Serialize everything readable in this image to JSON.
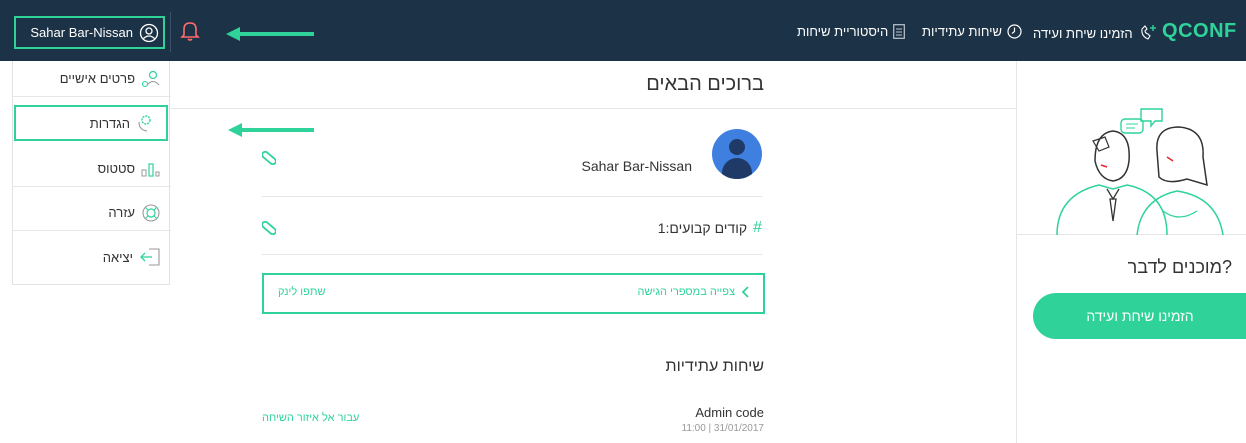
{
  "topbar": {
    "user_name": "Sahar Bar-Nissan",
    "nav": {
      "history": "היסטוריית שיחות",
      "future": "שיחות עתידיות",
      "invite": "הזמינו שיחת ועידה"
    },
    "logo_q": "Q",
    "logo_text": "CONF"
  },
  "menu": {
    "items": [
      {
        "label": "פרטים אישיים",
        "icon": "person-icon"
      },
      {
        "label": "הגדרות",
        "icon": "settings-icon"
      },
      {
        "label": "סטטוס",
        "icon": "status-icon"
      },
      {
        "label": "עזרה",
        "icon": "help-icon"
      },
      {
        "label": "יציאה",
        "icon": "logout-icon"
      }
    ]
  },
  "main": {
    "welcome": "ברוכים הבאים",
    "profile_name": "Sahar Bar-Nissan",
    "codes": "קודים קבועים:1",
    "link_view": "צפייה במספרי הגישה",
    "link_share": "שתפו לינק",
    "future_title": "שיחות עתידיות",
    "conf_code": "Admin code",
    "conf_time": "11:00 | 31/01/2017",
    "goto_area": "עבור אל איזור השיחה"
  },
  "right": {
    "ready": "מוכנים לדבר?",
    "cta": "הזמינו שיחת ועידה"
  },
  "colors": {
    "topbar": "#1c3246",
    "accent": "#2fd39a",
    "avatar": "#3e7fe0"
  }
}
